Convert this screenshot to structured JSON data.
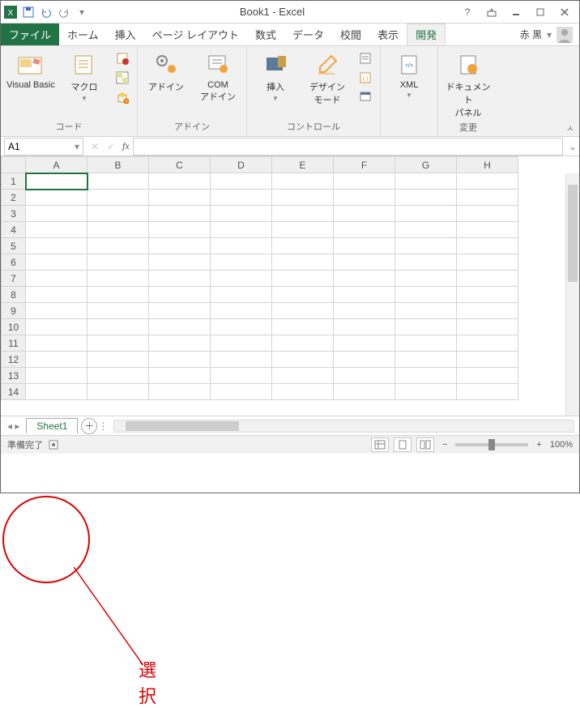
{
  "title": "Book1 - Excel",
  "qat": {
    "icons": [
      "excel-icon",
      "save-icon",
      "undo-icon",
      "redo-icon",
      "customize-icon"
    ]
  },
  "tabs": {
    "file": "ファイル",
    "items": [
      "ホーム",
      "挿入",
      "ページ レイアウト",
      "数式",
      "データ",
      "校閲",
      "表示",
      "開発"
    ],
    "active": "開発",
    "user": "赤 黒"
  },
  "ribbon": {
    "groups": [
      {
        "label": "コード",
        "buttons": [
          {
            "key": "visual-basic",
            "label": "Visual Basic"
          },
          {
            "key": "macro",
            "label": "マクロ"
          }
        ],
        "small": [
          "record-macro-icon",
          "relative-ref-icon",
          "macro-security-icon"
        ]
      },
      {
        "label": "アドイン",
        "buttons": [
          {
            "key": "addins",
            "label": "アドイン"
          },
          {
            "key": "com-addins",
            "label": "COM\nアドイン"
          }
        ]
      },
      {
        "label": "コントロール",
        "buttons": [
          {
            "key": "insert",
            "label": "挿入"
          },
          {
            "key": "design-mode",
            "label": "デザイン\nモード"
          }
        ],
        "small": [
          "properties-icon",
          "view-code-icon",
          "run-dialog-icon"
        ]
      },
      {
        "label": "",
        "buttons": [
          {
            "key": "xml",
            "label": "XML"
          }
        ]
      },
      {
        "label": "変更",
        "buttons": [
          {
            "key": "doc-panel",
            "label": "ドキュメント\nパネル"
          }
        ]
      }
    ]
  },
  "namebox": {
    "value": "A1"
  },
  "formula": {
    "fx": "fx"
  },
  "columns": [
    "A",
    "B",
    "C",
    "D",
    "E",
    "F",
    "G",
    "H"
  ],
  "rows": [
    "1",
    "2",
    "3",
    "4",
    "5",
    "6",
    "7",
    "8",
    "9",
    "10",
    "11",
    "12",
    "13",
    "14"
  ],
  "selected": {
    "row": 0,
    "col": 0
  },
  "sheets": {
    "active": "Sheet1"
  },
  "status": {
    "ready": "準備完了",
    "macro_rec": "",
    "zoom": "100%"
  },
  "annotation": {
    "label": "選択"
  }
}
